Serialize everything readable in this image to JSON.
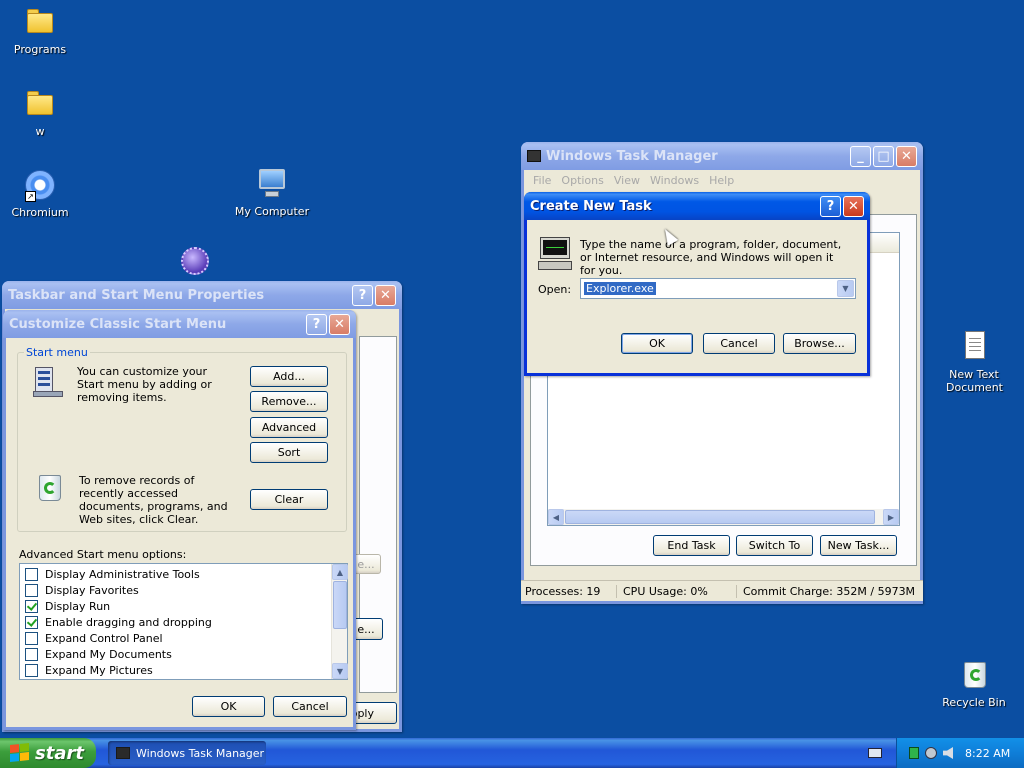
{
  "desktop": {
    "icons": [
      {
        "label": "Programs"
      },
      {
        "label": "w"
      },
      {
        "label": "Chromium"
      },
      {
        "label": "My Computer"
      },
      {
        "label": "New Text Document"
      },
      {
        "label": "Recycle Bin"
      }
    ]
  },
  "taskbar_props": {
    "title": "Taskbar and Start Menu Properties",
    "apply_label": "Apply"
  },
  "customize": {
    "title": "Customize Classic Start Menu",
    "group_label": "Start menu",
    "desc": "You can customize your Start menu by adding or removing items.",
    "add": "Add...",
    "remove": "Remove...",
    "advanced": "Advanced",
    "sort": "Sort",
    "clear_desc": "To remove records of recently accessed documents, programs, and Web sites, click Clear.",
    "clear": "Clear",
    "options_label": "Advanced Start menu options:",
    "options": [
      {
        "label": "Display Administrative Tools",
        "checked": false
      },
      {
        "label": "Display Favorites",
        "checked": false
      },
      {
        "label": "Display Run",
        "checked": true
      },
      {
        "label": "Enable dragging and dropping",
        "checked": true
      },
      {
        "label": "Expand Control Panel",
        "checked": false
      },
      {
        "label": "Expand My Documents",
        "checked": false
      },
      {
        "label": "Expand My Pictures",
        "checked": false
      }
    ],
    "ok": "OK",
    "cancel": "Cancel"
  },
  "task_manager": {
    "title": "Windows Task Manager",
    "menu": [
      "File",
      "Options",
      "View",
      "Windows",
      "Help"
    ],
    "end_task": "End Task",
    "switch_to": "Switch To",
    "new_task": "New Task...",
    "status": {
      "processes": "Processes: 19",
      "cpu": "CPU Usage: 0%",
      "commit": "Commit Charge: 352M / 5973M"
    }
  },
  "create_task": {
    "title": "Create New Task",
    "desc": "Type the name of a program, folder, document, or Internet resource, and Windows will open it for you.",
    "open_label": "Open:",
    "open_value": "Explorer.exe",
    "ok": "OK",
    "cancel": "Cancel",
    "browse": "Browse..."
  },
  "taskbar": {
    "start": "start",
    "task_button": "Windows Task Manager",
    "clock": "8:22 AM"
  },
  "colors": {
    "desktop": "#0b4ea2",
    "titlebar_active": "#0054e3",
    "titlebar_inactive": "#8ea8e8",
    "window_face": "#ece9d8",
    "start_green": "#3c9e3c"
  }
}
